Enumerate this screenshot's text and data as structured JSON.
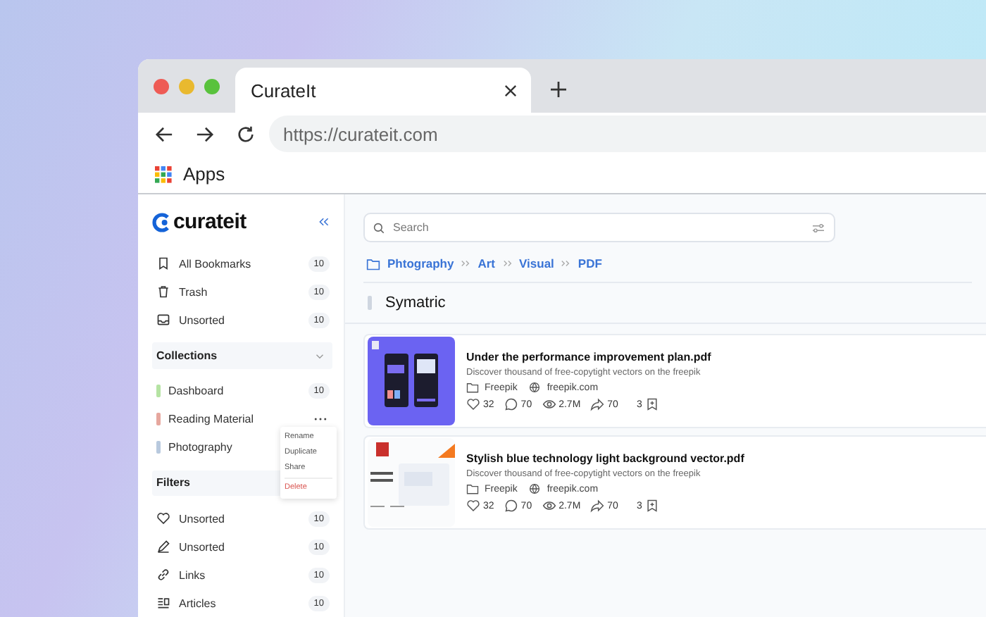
{
  "browser": {
    "tab_title": "CurateIt",
    "url": "https://curateit.com",
    "bookmarks": [
      {
        "label": "Apps"
      }
    ]
  },
  "sidebar": {
    "logo": "curateit",
    "nav": [
      {
        "kind": "bookmark",
        "label": "All Bookmarks",
        "count": "10"
      },
      {
        "kind": "trash",
        "label": "Trash",
        "count": "10"
      },
      {
        "kind": "inbox",
        "label": "Unsorted",
        "count": "10"
      }
    ],
    "collections": {
      "title": "Collections",
      "expanded": true,
      "items": [
        {
          "label": "Dashboard",
          "color": "#b5e3a3",
          "count": "10",
          "menu_open": false
        },
        {
          "label": "Reading Material",
          "color": "#e6a79e",
          "menu_open": true
        },
        {
          "label": "Photography",
          "color": "#b8c9de",
          "menu_open": false
        }
      ]
    },
    "context_menu": [
      {
        "label": "Rename",
        "kind": "normal"
      },
      {
        "label": "Duplicate",
        "kind": "normal"
      },
      {
        "label": "Share",
        "kind": "normal"
      },
      {
        "label": "Delete",
        "kind": "danger"
      }
    ],
    "filters": {
      "title": "Filters",
      "items": [
        {
          "kind": "heart",
          "label": "Unsorted",
          "count": "10"
        },
        {
          "kind": "pen",
          "label": "Unsorted",
          "count": "10"
        },
        {
          "kind": "link",
          "label": "Links",
          "count": "10"
        },
        {
          "kind": "article",
          "label": "Articles",
          "count": "10"
        }
      ]
    }
  },
  "main": {
    "search": {
      "placeholder": "Search"
    },
    "breadcrumb": [
      "Phtography",
      "Art",
      "Visual",
      "PDF"
    ],
    "section_title": "Symatric",
    "cards": [
      {
        "kind": "app-mockup",
        "title": "Under the performance improvement plan.pdf",
        "description": "Discover thousand of free-copytight vectors  on the freepik",
        "folder": "Freepik",
        "site": "freepik.com",
        "likes": "32",
        "comments": "70",
        "views": "2.7M",
        "shares": "70",
        "saves": "3"
      },
      {
        "kind": "document",
        "title": "Stylish blue technology light background vector.pdf",
        "description": "Discover thousand of free-copytight vectors  on the freepik",
        "folder": "Freepik",
        "site": "freepik.com",
        "likes": "32",
        "comments": "70",
        "views": "2.7M",
        "shares": "70",
        "saves": "3"
      }
    ]
  }
}
